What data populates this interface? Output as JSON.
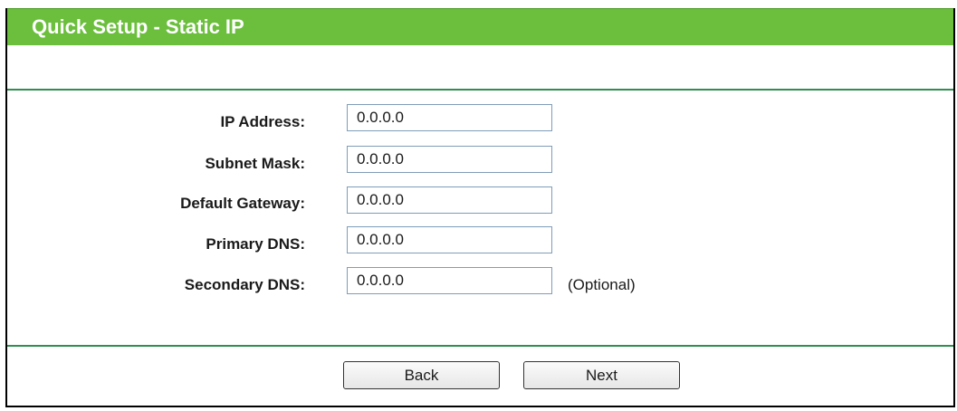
{
  "header": {
    "title": "Quick Setup - Static IP"
  },
  "form": {
    "fields": [
      {
        "label": "IP Address:",
        "value": "0.0.0.0"
      },
      {
        "label": "Subnet Mask:",
        "value": "0.0.0.0"
      },
      {
        "label": "Default Gateway:",
        "value": "0.0.0.0"
      },
      {
        "label": "Primary DNS:",
        "value": "0.0.0.0"
      },
      {
        "label": "Secondary DNS:",
        "value": "0.0.0.0",
        "note": "(Optional)"
      }
    ]
  },
  "buttons": {
    "back_label": "Back",
    "next_label": "Next"
  },
  "colors": {
    "title_bar": "#6bbf3c",
    "divider": "#2f8f51"
  }
}
